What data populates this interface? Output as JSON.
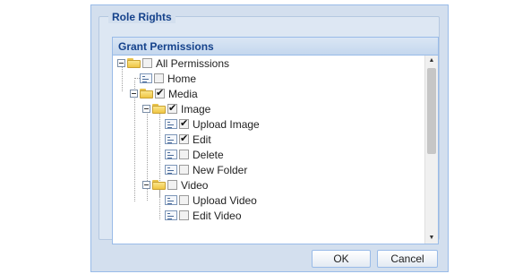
{
  "dialog": {
    "fieldset_legend": "Role Rights",
    "panel_title": "Grant Permissions",
    "tree": [
      {
        "label": "All Permissions",
        "checked": false,
        "kind": "folder"
      },
      {
        "label": "Home",
        "checked": false,
        "kind": "leaf"
      },
      {
        "label": "Media",
        "checked": true,
        "kind": "folder"
      },
      {
        "label": "Image",
        "checked": true,
        "kind": "folder"
      },
      {
        "label": "Upload Image",
        "checked": true,
        "kind": "leaf"
      },
      {
        "label": "Edit",
        "checked": true,
        "kind": "leaf"
      },
      {
        "label": "Delete",
        "checked": false,
        "kind": "leaf"
      },
      {
        "label": "New Folder",
        "checked": false,
        "kind": "leaf"
      },
      {
        "label": "Video",
        "checked": false,
        "kind": "folder"
      },
      {
        "label": "Upload Video",
        "checked": false,
        "kind": "leaf"
      },
      {
        "label": "Edit Video",
        "checked": false,
        "kind": "leaf"
      }
    ],
    "ok_label": "OK",
    "cancel_label": "Cancel"
  },
  "colors": {
    "accent": "#15428b",
    "border": "#99bbe8",
    "background": "#d3dfee"
  }
}
